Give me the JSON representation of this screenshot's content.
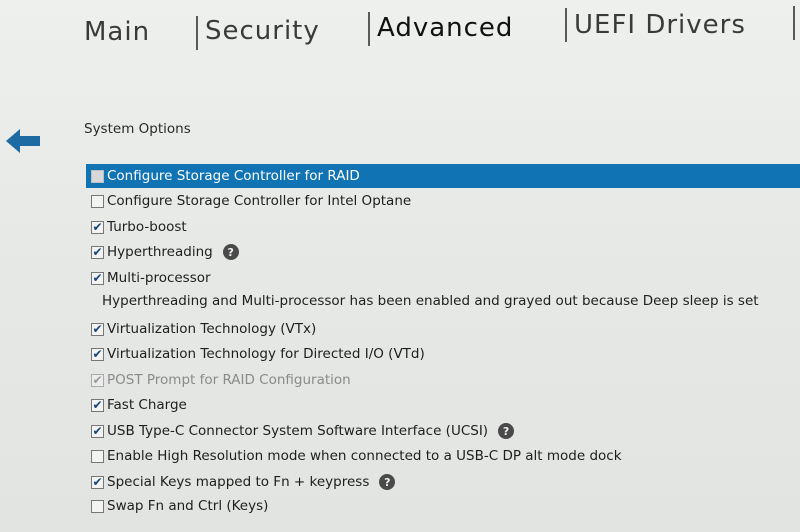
{
  "tabs": [
    {
      "label": "Main"
    },
    {
      "label": "Security"
    },
    {
      "label": "Advanced"
    },
    {
      "label": "UEFI Drivers"
    }
  ],
  "section_title": "System Options",
  "colors": {
    "selection": "#0f73b4",
    "back_arrow": "#1e6aa3"
  },
  "options": [
    {
      "label": "Configure Storage Controller for RAID",
      "checked": false,
      "selected": true
    },
    {
      "label": "Configure Storage Controller for Intel Optane",
      "checked": false
    },
    {
      "label": "Turbo-boost",
      "checked": true
    },
    {
      "label": "Hyperthreading",
      "checked": true,
      "help": true
    },
    {
      "label": "Multi-processor",
      "checked": true
    },
    {
      "label": "Virtualization Technology (VTx)",
      "checked": true
    },
    {
      "label": "Virtualization Technology for Directed I/O (VTd)",
      "checked": true
    },
    {
      "label": "POST Prompt for RAID Configuration",
      "checked": true,
      "grayed": true
    },
    {
      "label": "Fast Charge",
      "checked": true
    },
    {
      "label": "USB Type-C Connector System Software Interface (UCSI)",
      "checked": true,
      "help": true
    },
    {
      "label": "Enable High Resolution mode when connected to a USB-C DP alt mode dock",
      "checked": false
    },
    {
      "label": "Special Keys mapped to Fn + keypress",
      "checked": true,
      "help": true
    },
    {
      "label": "Swap Fn and Ctrl (Keys)",
      "checked": false
    }
  ],
  "info_text": "Hyperthreading and Multi-processor has been enabled and grayed out because Deep sleep is set",
  "help_glyph": "?",
  "check_glyph": "✔"
}
